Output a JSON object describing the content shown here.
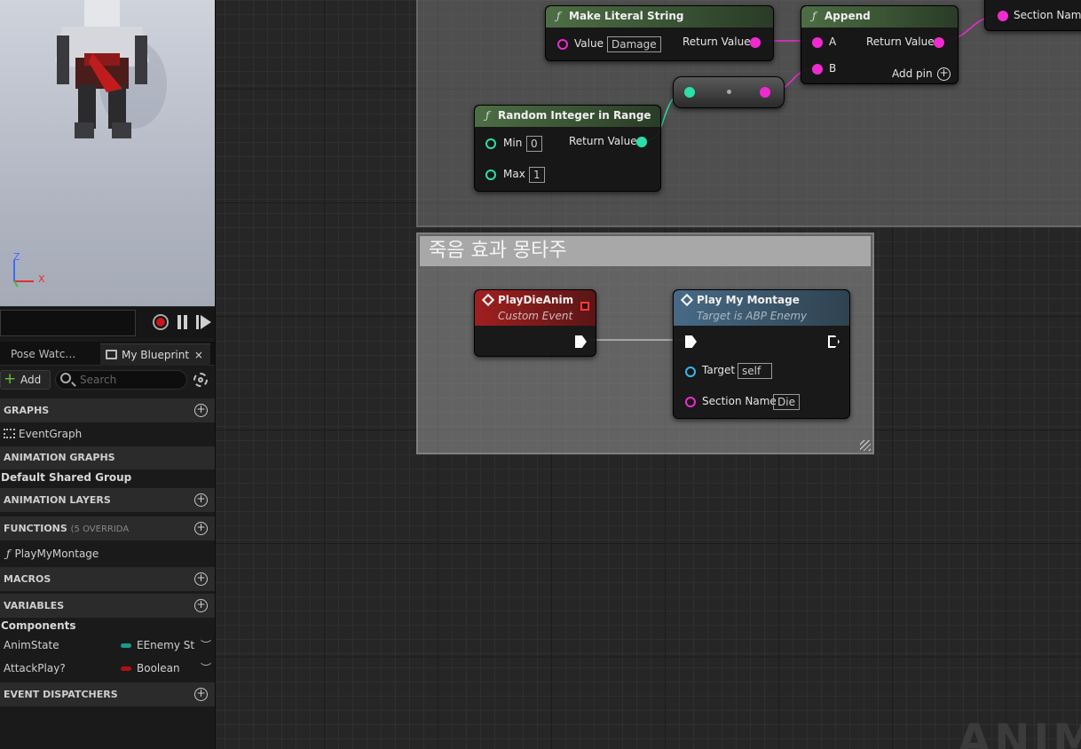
{
  "left": {
    "viewport": {
      "axis_z": "Z",
      "axis_x": "X"
    },
    "tabs": {
      "pose_watch": "Pose Watc…",
      "my_blueprint": "My Blueprint",
      "close": "×"
    },
    "toolbar": {
      "add_label": "Add",
      "search_placeholder": "Search"
    },
    "sections": {
      "graphs": "GRAPHS",
      "animation_graphs": "ANIMATION GRAPHS",
      "animation_layers": "ANIMATION LAYERS",
      "functions": "FUNCTIONS",
      "functions_sub": "(5 OVERRIDA",
      "macros": "MACROS",
      "variables": "VARIABLES",
      "event_dispatchers": "EVENT DISPATCHERS"
    },
    "items": {
      "event_graph": "EventGraph",
      "default_shared_group": "Default Shared Group",
      "play_my_montage": "PlayMyMontage",
      "components": "Components"
    },
    "variables": [
      {
        "name": "AnimState",
        "type": "EEnemy St",
        "color": "#1a9a8a"
      },
      {
        "name": "AttackPlay?",
        "type": "Boolean",
        "color": "#b01010"
      }
    ]
  },
  "graph": {
    "comment_title": "죽음 효과 몽타주",
    "watermark": "ANIM",
    "nodes": {
      "make_literal": {
        "title": "Make Literal String",
        "in_label": "Value",
        "in_value": "Damage",
        "out_label": "Return Value"
      },
      "append": {
        "title": "Append",
        "a": "A",
        "b": "B",
        "out_label": "Return Value",
        "add_pin": "Add pin"
      },
      "random_int": {
        "title": "Random Integer in Range",
        "min_label": "Min",
        "min_value": "0",
        "max_label": "Max",
        "max_value": "1",
        "out_label": "Return Value"
      },
      "section_node": {
        "label": "Section Name"
      },
      "play_die": {
        "title": "PlayDieAnim",
        "sub": "Custom Event"
      },
      "play_montage": {
        "title": "Play My Montage",
        "sub": "Target is ABP Enemy",
        "target_label": "Target",
        "target_value": "self",
        "section_label": "Section Name",
        "section_value": "Die"
      }
    }
  }
}
